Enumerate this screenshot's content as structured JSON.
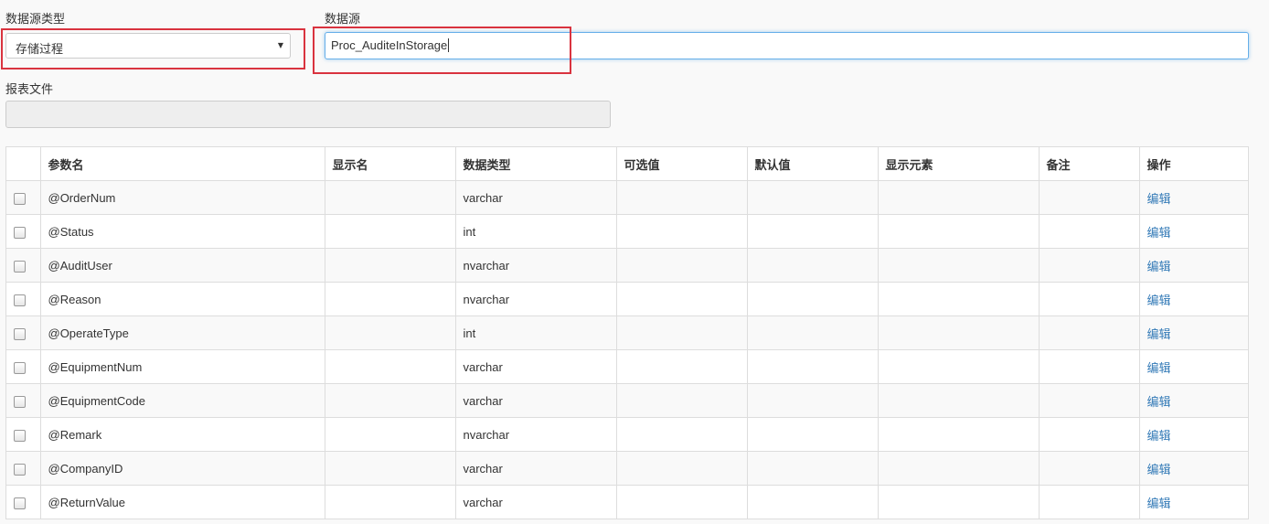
{
  "form": {
    "datasource_type_label": "数据源类型",
    "datasource_type_value": "存储过程",
    "datasource_label": "数据源",
    "datasource_value": "Proc_AuditeInStorage",
    "report_file_label": "报表文件",
    "report_file_value": ""
  },
  "table": {
    "headers": [
      "参数名",
      "显示名",
      "数据类型",
      "可选值",
      "默认值",
      "显示元素",
      "备注",
      "操作"
    ],
    "rows": [
      {
        "name": "@OrderNum",
        "display": "",
        "type": "varchar",
        "options": "",
        "default": "",
        "element": "",
        "remark": "",
        "action": "编辑"
      },
      {
        "name": "@Status",
        "display": "",
        "type": "int",
        "options": "",
        "default": "",
        "element": "",
        "remark": "",
        "action": "编辑"
      },
      {
        "name": "@AuditUser",
        "display": "",
        "type": "nvarchar",
        "options": "",
        "default": "",
        "element": "",
        "remark": "",
        "action": "编辑"
      },
      {
        "name": "@Reason",
        "display": "",
        "type": "nvarchar",
        "options": "",
        "default": "",
        "element": "",
        "remark": "",
        "action": "编辑"
      },
      {
        "name": "@OperateType",
        "display": "",
        "type": "int",
        "options": "",
        "default": "",
        "element": "",
        "remark": "",
        "action": "编辑"
      },
      {
        "name": "@EquipmentNum",
        "display": "",
        "type": "varchar",
        "options": "",
        "default": "",
        "element": "",
        "remark": "",
        "action": "编辑"
      },
      {
        "name": "@EquipmentCode",
        "display": "",
        "type": "varchar",
        "options": "",
        "default": "",
        "element": "",
        "remark": "",
        "action": "编辑"
      },
      {
        "name": "@Remark",
        "display": "",
        "type": "nvarchar",
        "options": "",
        "default": "",
        "element": "",
        "remark": "",
        "action": "编辑"
      },
      {
        "name": "@CompanyID",
        "display": "",
        "type": "varchar",
        "options": "",
        "default": "",
        "element": "",
        "remark": "",
        "action": "编辑"
      },
      {
        "name": "@ReturnValue",
        "display": "",
        "type": "varchar",
        "options": "",
        "default": "",
        "element": "",
        "remark": "",
        "action": "编辑"
      }
    ]
  },
  "colors": {
    "highlight": "#d9333f",
    "link": "#337ab7",
    "focus_border": "#66afe9"
  }
}
